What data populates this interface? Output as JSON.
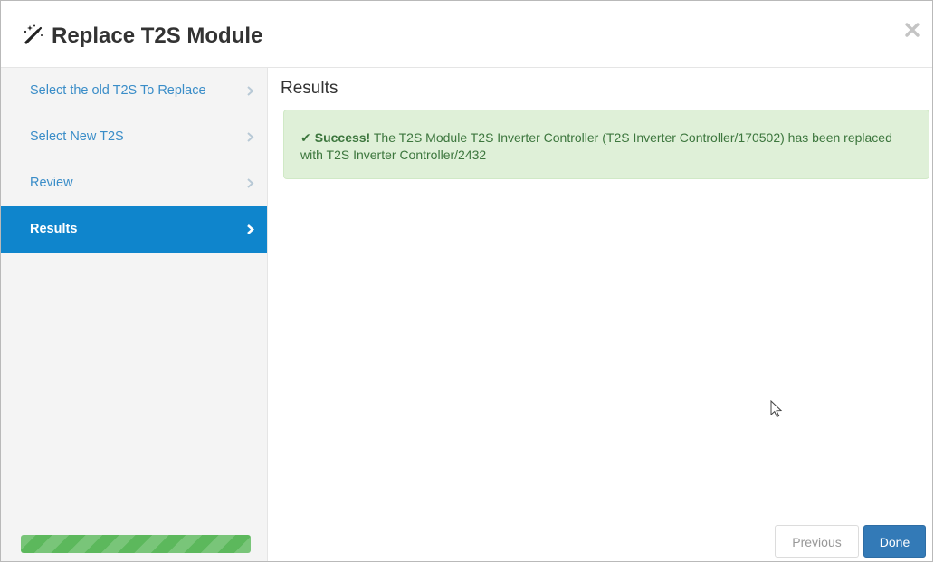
{
  "dialog": {
    "title": "Replace T2S Module",
    "icon": "magic-wand-icon",
    "close_icon": "close-icon"
  },
  "steps": [
    {
      "label": "Select the old T2S To Replace",
      "active": false
    },
    {
      "label": "Select New T2S",
      "active": false
    },
    {
      "label": "Review",
      "active": false
    },
    {
      "label": "Results",
      "active": true
    }
  ],
  "progress": {
    "value": 1.0,
    "color": "#5cb85c"
  },
  "content": {
    "heading": "Results",
    "alert": {
      "check": "✔",
      "strong": "Success!",
      "message": " The T2S Module T2S Inverter Controller (T2S Inverter Controller/170502) has been replaced with T2S Inverter Controller/2432"
    }
  },
  "footer": {
    "previous_label": "Previous",
    "done_label": "Done"
  },
  "colors": {
    "active_step": "#0f85cc",
    "step_link": "#3a8dc8",
    "success_bg": "#dff0d8",
    "success_text": "#3c763d",
    "primary_button": "#337ab7"
  }
}
